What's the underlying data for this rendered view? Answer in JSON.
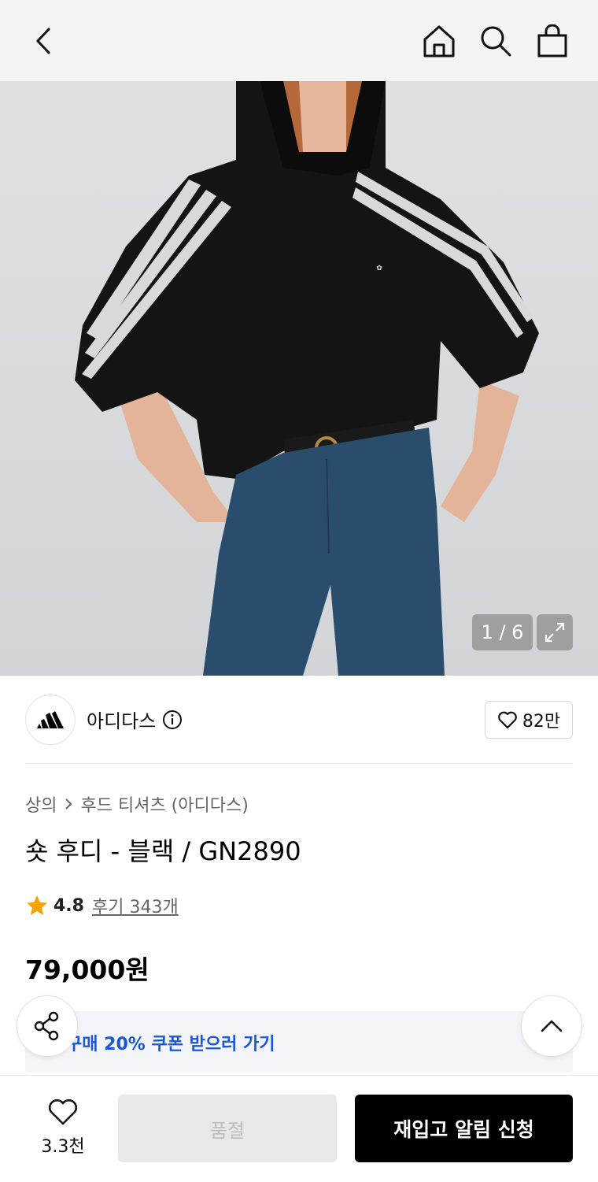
{
  "product": {
    "image_counter": "1 / 6",
    "brand_name": "아디다스",
    "brand_likes": "82만",
    "breadcrumb": [
      "상의",
      "후드 티셔츠 (아디다스)"
    ],
    "title": "숏 후디 - 블랙 / GN2890",
    "rating": "4.8",
    "reviews": "후기 343개",
    "price": "79,000원",
    "coupon_text": "구매 20% 쿠폰 받으러 가기"
  },
  "bottom_bar": {
    "wish_count": "3.3천",
    "soldout_label": "품절",
    "restock_label": "재입고 알림 신청"
  },
  "icons": {
    "back": "chevron-left-icon",
    "home": "home-icon",
    "search": "search-icon",
    "cart": "shopping-bag-icon",
    "expand": "expand-icon",
    "brand_info": "info-icon",
    "like": "heart-icon",
    "star": "star-icon",
    "share": "share-icon",
    "scroll_top": "chevron-up-icon"
  },
  "colors": {
    "accent_blue": "#1a56d8",
    "star": "#f5a300",
    "primary_button": "#000000",
    "disabled_button": "#e8e8e8"
  }
}
